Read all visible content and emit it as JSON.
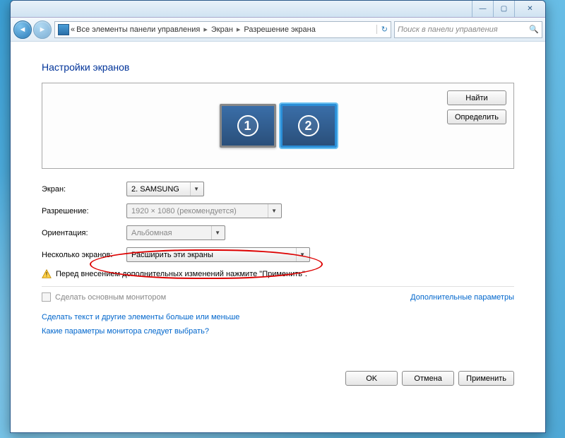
{
  "titlebar": {
    "minimize": "—",
    "maximize": "▢",
    "close": "✕"
  },
  "nav": {
    "back": "◄",
    "forward": "►"
  },
  "breadcrumb": {
    "sep1": "«",
    "part1": "Все элементы панели управления",
    "part2": "Экран",
    "part3": "Разрешение экрана",
    "sep": "▸",
    "refresh": "↻"
  },
  "search": {
    "placeholder": "Поиск в панели управления",
    "icon": "🔍"
  },
  "heading": "Настройки экранов",
  "monitors": {
    "one": "1",
    "two": "2"
  },
  "side": {
    "find": "Найти",
    "identify": "Определить"
  },
  "form": {
    "screen_label": "Экран:",
    "screen_value": "2. SAMSUNG",
    "resolution_label": "Разрешение:",
    "resolution_value": "1920 × 1080 (рекомендуется)",
    "orientation_label": "Ориентация:",
    "orientation_value": "Альбомная",
    "multi_label": "Несколько экранов:",
    "multi_value": "Расширить эти экраны"
  },
  "warning": "Перед внесением дополнительных изменений нажмите \"Применить\".",
  "checkbox_label": "Сделать основным монитором",
  "adv_params": "Дополнительные параметры",
  "link1": "Сделать текст и другие элементы больше или меньше",
  "link2": "Какие параметры монитора следует выбрать?",
  "buttons": {
    "ok": "OK",
    "cancel": "Отмена",
    "apply": "Применить"
  }
}
